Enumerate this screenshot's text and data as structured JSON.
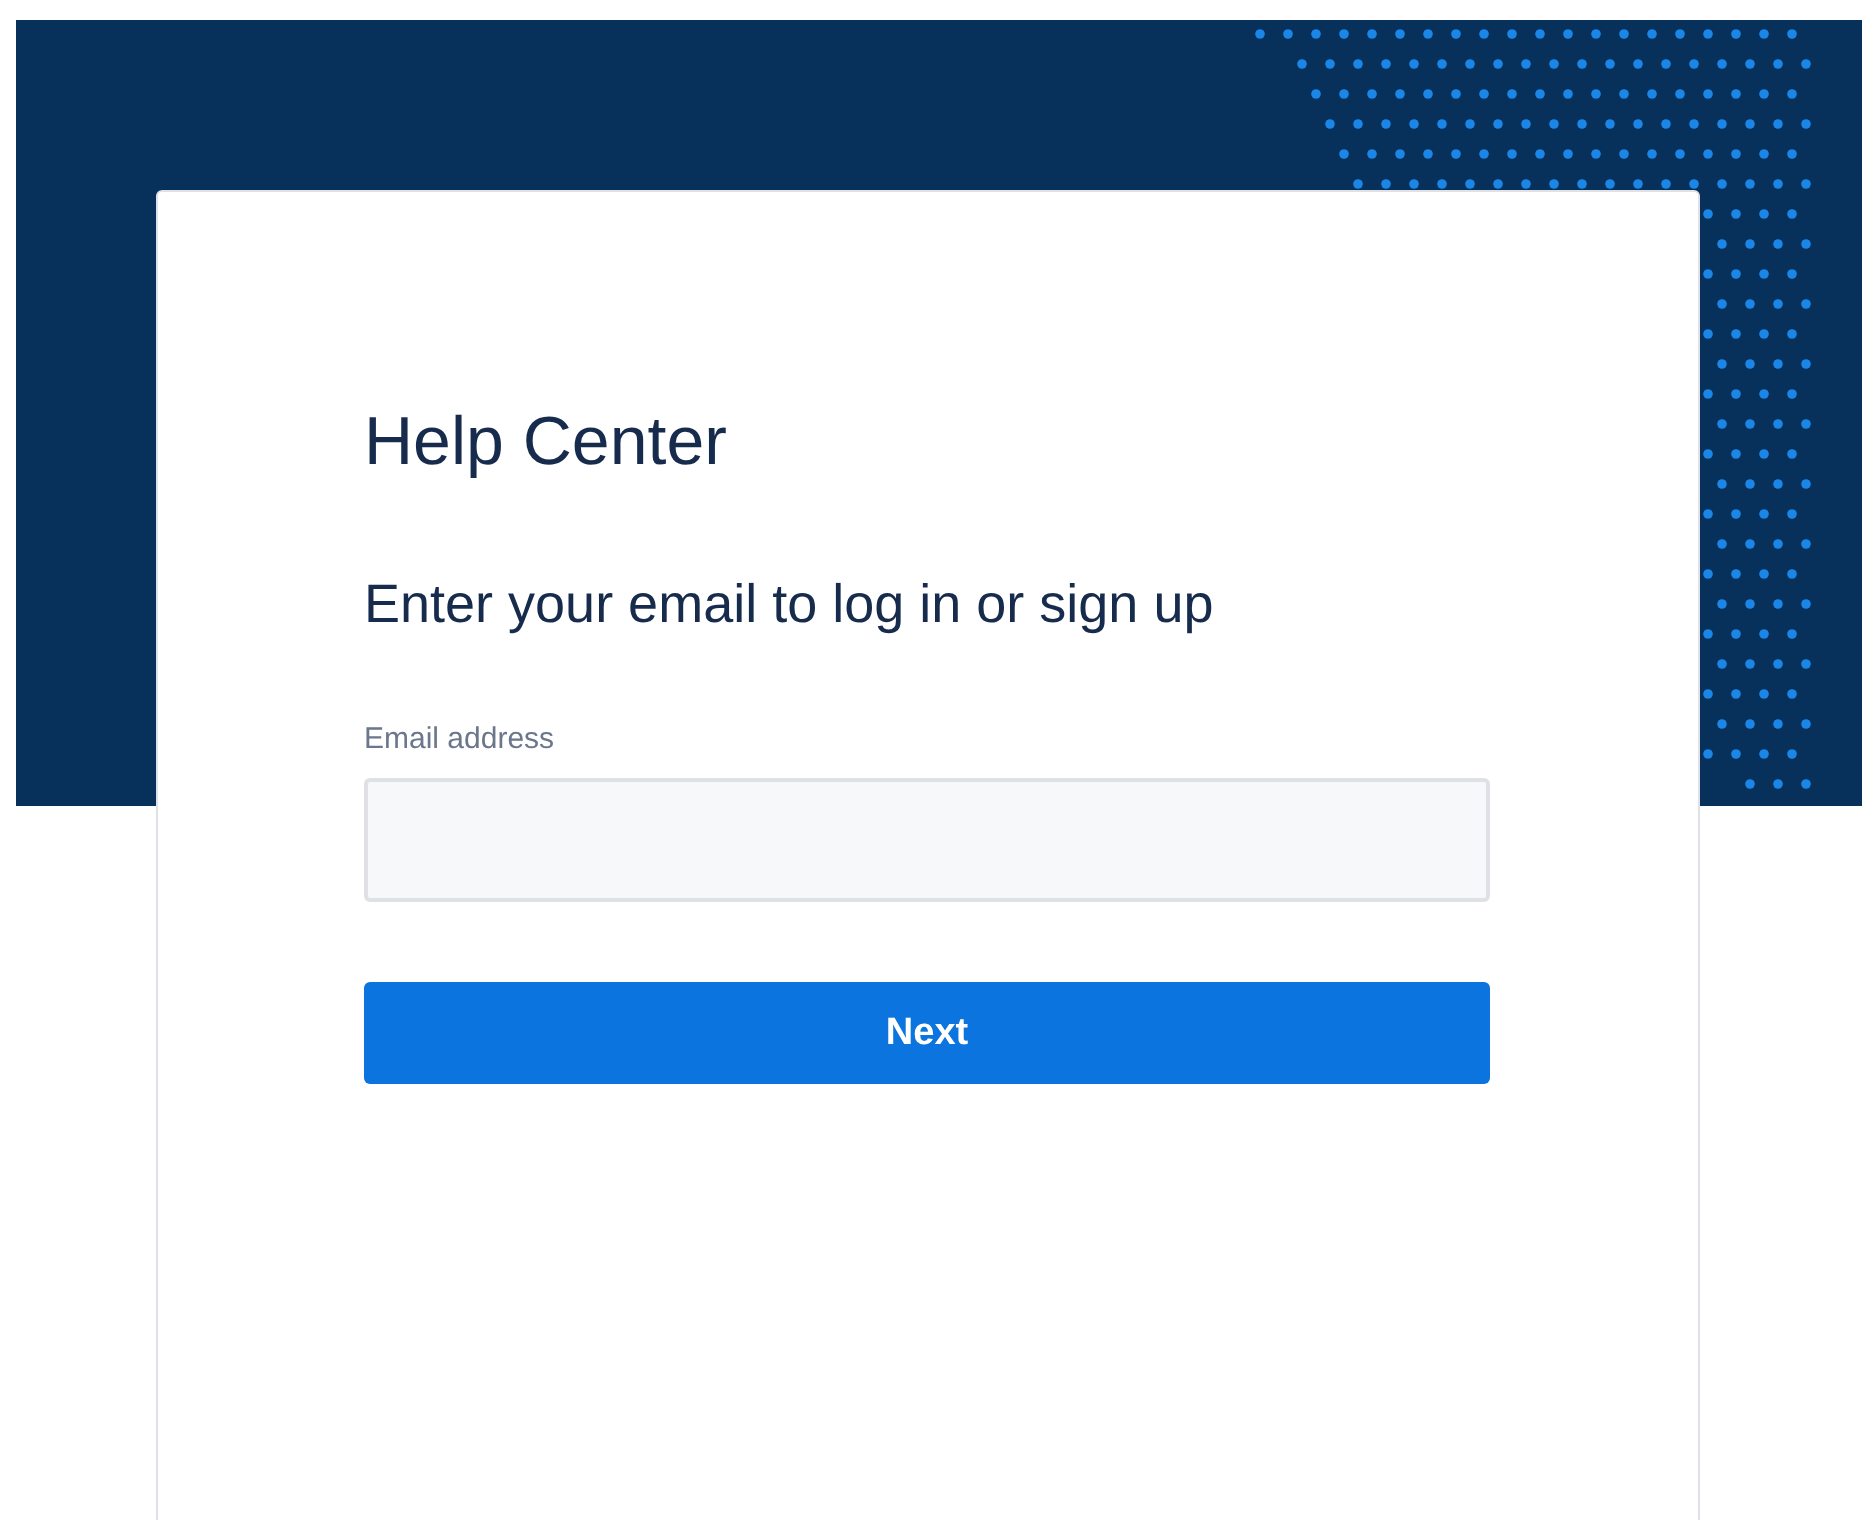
{
  "card": {
    "title": "Help Center",
    "heading": "Enter your email to log in or sign up",
    "email_field": {
      "label": "Email address"
    },
    "next_button": {
      "label": "Next"
    }
  }
}
